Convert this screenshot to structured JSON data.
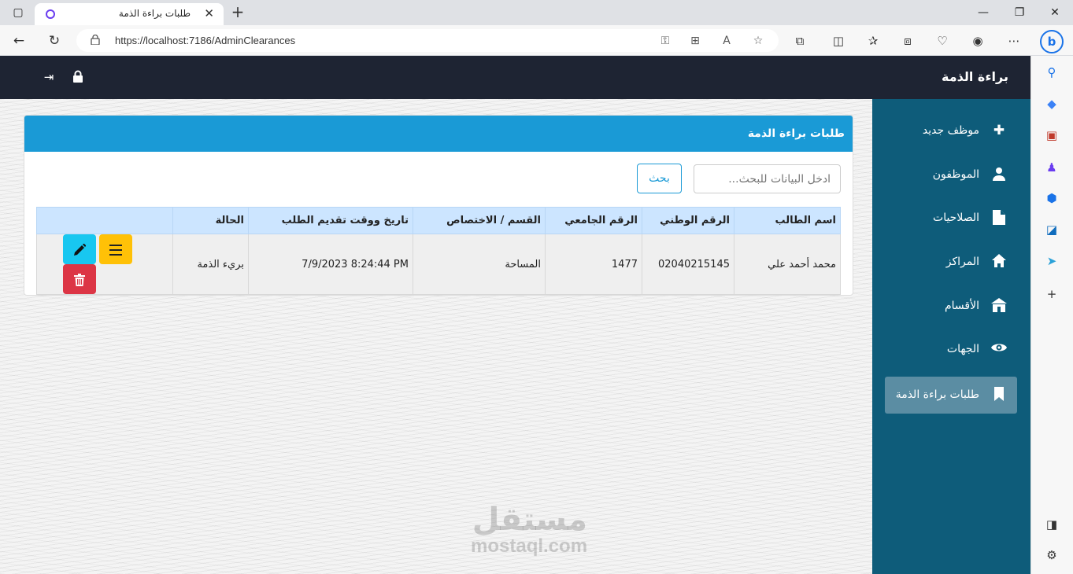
{
  "browser": {
    "tab_title": "طلبات براءة الذمة",
    "url": "https://localhost:7186/AdminClearances"
  },
  "app": {
    "brand": "براءة الذمة",
    "sidebar": {
      "items": [
        {
          "label": "موظف جديد",
          "icon": "plus-icon"
        },
        {
          "label": "الموظفون",
          "icon": "user-icon"
        },
        {
          "label": "الصلاحيات",
          "icon": "file-icon"
        },
        {
          "label": "المراكز",
          "icon": "home-icon"
        },
        {
          "label": "الأقسام",
          "icon": "building-icon"
        },
        {
          "label": "الجهات",
          "icon": "eye-icon"
        },
        {
          "label": "طلبات براءة الذمة",
          "icon": "bookmark-icon",
          "active": true
        }
      ]
    },
    "card": {
      "title": "طلبات براءة الذمة",
      "search_placeholder": "ادخل البيانات للبحث...",
      "search_button": "بحث"
    },
    "table": {
      "headers": [
        "اسم الطالب",
        "الرقم الوطني",
        "الرقم الجامعي",
        "القسم / الاختصاص",
        "تاريخ ووقت تقديم الطلب",
        "الحالة"
      ],
      "rows": [
        {
          "student_name": "محمد أحمد علي",
          "national_id": "02040215145",
          "university_id": "1477",
          "department": "المساحة",
          "submitted_at": "7/9/2023 8:24:44 PM",
          "status": "بريء الذمة"
        }
      ]
    },
    "watermark": {
      "arabic": "مستقل",
      "latin": "mostaql.com"
    }
  },
  "colors": {
    "topbar": "#1e2433",
    "sidebar": "#0e5c7a",
    "card_header": "#1a9ad6",
    "btn_menu": "#ffc107",
    "btn_edit": "#18c7f0",
    "btn_delete": "#dc3545"
  }
}
